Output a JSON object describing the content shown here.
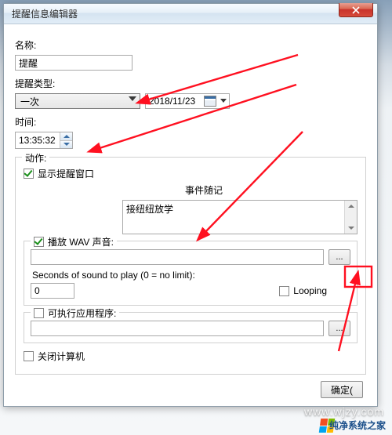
{
  "window": {
    "title": "提醒信息编辑器"
  },
  "labels": {
    "name": "名称:",
    "type": "提醒类型:",
    "time": "时间:",
    "action": "动作:",
    "event_note": "事件随记",
    "seconds": "Seconds of sound to play (0 = no limit):",
    "looping": "Looping"
  },
  "fields": {
    "name_value": "提醒",
    "type_value": "一次",
    "date_value": "2018/11/23",
    "time_value": "13:35:32",
    "note_value": "接纽纽放学",
    "wav_path": "",
    "seconds_value": "0",
    "exec_path": ""
  },
  "checkboxes": {
    "show_window": {
      "label": "显示提醒窗口",
      "checked": true
    },
    "play_wav": {
      "label": "播放 WAV 声音:",
      "checked": true
    },
    "looping": {
      "checked": false
    },
    "exec": {
      "label": "可执行应用程序:",
      "checked": false
    },
    "shutdown": {
      "label": "关闭计算机",
      "checked": false
    }
  },
  "buttons": {
    "browse": "...",
    "ok": "确定("
  },
  "watermark": "www.wjzy.com",
  "brand": "纯净系统之家"
}
